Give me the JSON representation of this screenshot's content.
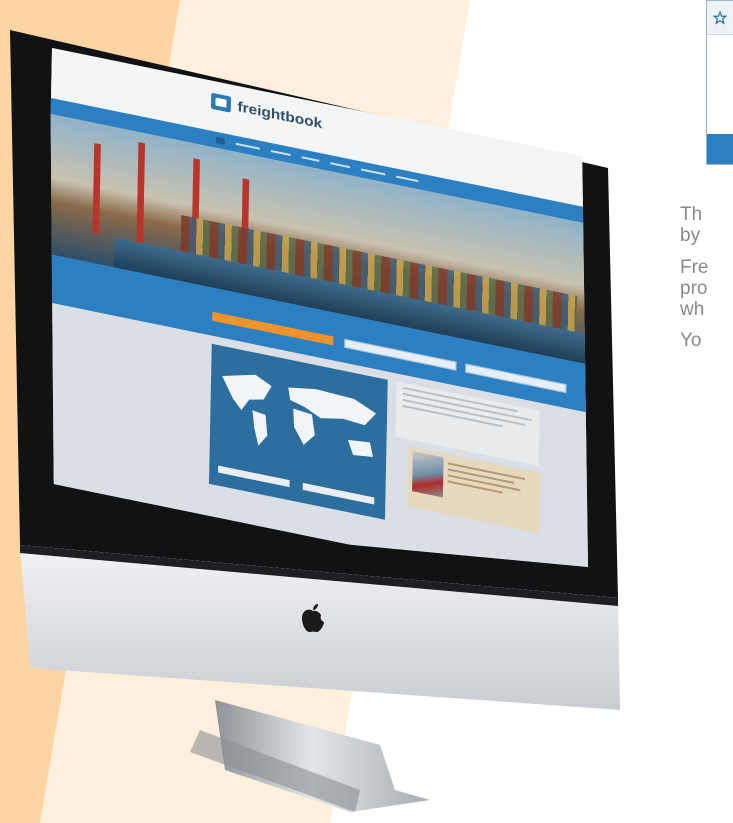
{
  "side_panel": {
    "star_icon": "star-icon",
    "text_lines": [
      "Th",
      "by",
      "Fre",
      "pro",
      "wh",
      "Yo"
    ]
  },
  "website": {
    "logo_text": "freightbook",
    "logo_icon": "book-icon",
    "brand_color": "#2c7fc1",
    "accent_color": "#f0922e"
  },
  "device": {
    "logo_icon": "apple-logo-icon"
  },
  "colors": {
    "stripe_orange": "#fcd9a8",
    "stripe_cream": "#fef0dc",
    "card_border": "#9db5cc",
    "side_text": "#8a8a8a"
  }
}
